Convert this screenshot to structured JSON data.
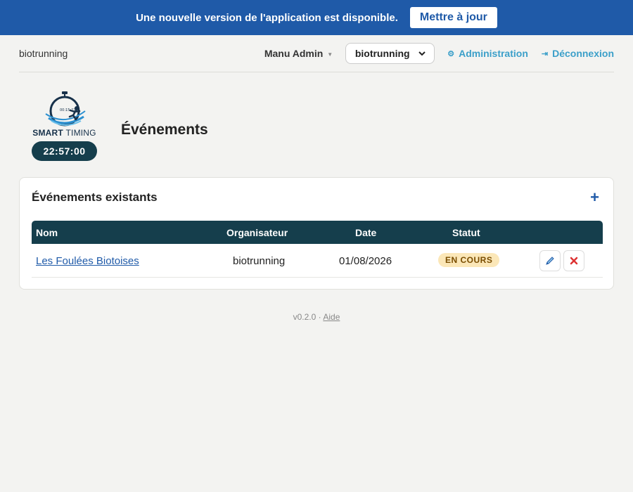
{
  "banner": {
    "message": "Une nouvelle version de l'application est disponible.",
    "button_label": "Mettre à jour"
  },
  "topbar": {
    "org_name": "biotrunning",
    "user_name": "Manu Admin",
    "org_select_value": "biotrunning",
    "admin_label": "Administration",
    "logout_label": "Déconnexion"
  },
  "brand": {
    "logo_text_bold": "SMART",
    "logo_text_light": "TIMING",
    "watch_text": "00:15:22",
    "clock": "22:57:00"
  },
  "page": {
    "title": "Événements"
  },
  "events_card": {
    "title": "Événements existants",
    "add_icon": "plus-icon",
    "columns": [
      "Nom",
      "Organisateur",
      "Date",
      "Statut"
    ],
    "rows": [
      {
        "name": "Les Foulées Biotoises",
        "organizer": "biotrunning",
        "date": "01/08/2026",
        "status": "EN COURS",
        "actions": [
          "pencil-icon",
          "close-icon"
        ]
      }
    ]
  },
  "footer": {
    "version": "v0.2.0",
    "separator": "·",
    "help_label": "Aide"
  },
  "colors": {
    "banner": "#1f5aa8",
    "table_header": "#153e4c",
    "link": "#3b9fc9",
    "status_bg": "#fbe7b8",
    "status_text": "#7a4d00",
    "delete": "#dd3333"
  }
}
